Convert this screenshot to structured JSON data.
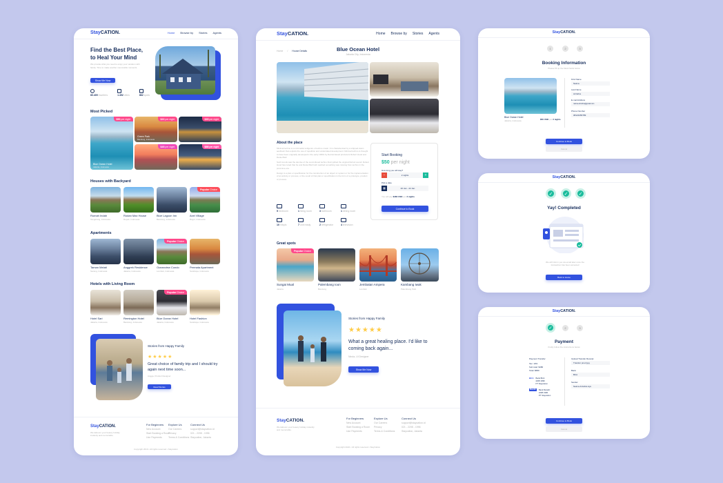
{
  "brand": {
    "stay": "Stay",
    "cation": "CATION."
  },
  "colors": {
    "primary": "#3252df",
    "navy": "#152c5b",
    "pink": "#ff498b",
    "green": "#1abc9c",
    "gray": "#b0b0b0"
  },
  "nav": {
    "home": "Home",
    "browse": "Browse by",
    "stories": "Stories",
    "agents": "Agents"
  },
  "landing": {
    "hero_title_1": "Find the Best Place,",
    "hero_title_2": "to Heal Your Mind",
    "hero_text": "We provide what you need to enjoy your vacation with family. Time to make another memorable moments.",
    "hero_button": "Show Me Now",
    "stats": [
      {
        "value": "80.409",
        "label": "travelers",
        "icon": "traveler-icon"
      },
      {
        "value": "1.492",
        "label": "cities",
        "icon": "treasure-icon"
      },
      {
        "value": "862",
        "label": "spots",
        "icon": "city-icon"
      }
    ],
    "most_picked_title": "Most Picked",
    "most_picked": [
      {
        "name": "Blue Ocean Hotel",
        "place": "Jakarta, Indonesia",
        "price": "$50",
        "unit": "per night"
      },
      {
        "name": "Green Park",
        "place": "Bandung, Indonesia",
        "price": "$22",
        "unit": "per night"
      },
      {
        "name": "",
        "place": "",
        "price": "$35",
        "unit": "per night"
      },
      {
        "name": "",
        "place": "",
        "price": "$45",
        "unit": "per night"
      },
      {
        "name": "",
        "place": "",
        "price": "$30",
        "unit": "per night"
      }
    ],
    "backyard_title": "Houses with Backyard",
    "backyard": [
      {
        "name": "Rumah Indah",
        "place": "Tangerang, Indonesia",
        "tag": ""
      },
      {
        "name": "Rodan Max House",
        "place": "Depok, Indonesia",
        "tag": ""
      },
      {
        "name": "Blue Lagoon Inn",
        "place": "Bandung, Indonesia",
        "tag": ""
      },
      {
        "name": "Axel Village",
        "place": "Bogor, Indonesia",
        "tag_b": "Popular",
        "tag": "Choice"
      }
    ],
    "apartments_title": "Apartments",
    "apartments": [
      {
        "name": "Taman Melati",
        "place": "Serang, Indonesia",
        "tag": ""
      },
      {
        "name": "Anggrek Residence",
        "place": "Jakarta, Indonesia",
        "tag": ""
      },
      {
        "name": "Oceanview Condo",
        "place": "Lombok, Indonesia",
        "tag_b": "Popular",
        "tag": "Choice"
      },
      {
        "name": "Permata Apartment",
        "place": "Surabaya, Indonesia",
        "tag": ""
      }
    ],
    "living_title": "Hotels with Living Room",
    "living": [
      {
        "name": "Hotel Sari",
        "place": "Jakarta, Indonesia",
        "tag": ""
      },
      {
        "name": "Remington Hotel",
        "place": "Bandung, Indonesia",
        "tag": ""
      },
      {
        "name": "Blue Ocean Hotel",
        "place": "Jakarta, Indonesia",
        "tag_b": "Popular",
        "tag": "Choice"
      },
      {
        "name": "Hotel Fashion",
        "place": "Surabaya, Indonesia",
        "tag": ""
      }
    ],
    "testimonial_heading": "Stories from Happy Family",
    "testimonial_quote": "Great choice of family trip and I should try again next time soon...",
    "testimonial_author": "Angga, Product Designer",
    "testimonial_button": "Read Stories",
    "footer_tagline": "We kaboom your beauty holiday instantly and memorable.",
    "footer_cols": [
      {
        "title": "For Beginners",
        "items": [
          "New Account",
          "Start Booking a Room",
          "Use Payments"
        ]
      },
      {
        "title": "Explore Us",
        "items": [
          "Our Careers",
          "Privacy",
          "Terms & Conditions"
        ]
      },
      {
        "title": "Connect Us",
        "items": [
          "support@staycation.id",
          "021 - 2208 - 1996",
          "Staycation, Jakarta"
        ]
      }
    ],
    "copyright": "Copyright 2019 • All rights reserved • Staycation"
  },
  "detail": {
    "breadcrumb_home": "Home",
    "breadcrumb_sep": "/",
    "breadcrumb_current": "House Details",
    "title": "Blue Ocean Hotel",
    "subtitle": "Jakarta City, Indonesia",
    "about_title": "About the place",
    "about_p1": "Minimal techno is a minimalist subgenre of techno music. It is characterized by a stripped-down aesthetic that exploits the use of repetition and understated development. Minimal techno is thought to have been originally developed in the early 1990s by Detroit-based producers Robert Hood and Daniel Bell.",
    "about_p2": "Such trends saw the demise of the soul-infused techno that typified the original Detroit sound. Robert Hood has noted that he and Daniel Bell both realized something was missing from techno in the post-rave era.",
    "about_p3": "Design is a plan or specification for the construction of an object or system or for the implementation of an activity or process, or the result of that plan or specification in the form of a prototype, product or process.",
    "amenities": [
      {
        "value": "5",
        "label": "bedroom",
        "icon": "bed-icon"
      },
      {
        "value": "1",
        "label": "living room",
        "icon": "sofa-icon"
      },
      {
        "value": "3",
        "label": "bathroom",
        "icon": "bath-icon"
      },
      {
        "value": "1",
        "label": "dining room",
        "icon": "dining-icon"
      },
      {
        "value": "10",
        "label": "mbp/s",
        "icon": "wifi-icon"
      },
      {
        "value": "7",
        "label": "unit ready",
        "icon": "ac-icon"
      },
      {
        "value": "2",
        "label": "refrigerator",
        "icon": "fridge-icon"
      },
      {
        "value": "4",
        "label": "television",
        "icon": "tv-icon"
      }
    ],
    "booking": {
      "title": "Start Booking",
      "price": "$50",
      "unit": "per night",
      "stay_label": "How long you will stay?",
      "stay_value": "2 nights",
      "date_label": "Pick a date",
      "date_value": "20 Jan - 22 Jan",
      "summary_pre": "You will pay",
      "summary_amount": "$480 USD",
      "summary_mid": "per",
      "summary_nights": "2 nights",
      "button": "Continue to Book"
    },
    "spots_title": "Great spots",
    "spots": [
      {
        "name": "Sungai Mual",
        "place": "Jakarta",
        "tag_b": "Popular",
        "tag": "Choice"
      },
      {
        "name": "Palembang Ioon",
        "place": "Bandung",
        "tag": ""
      },
      {
        "name": "Jembatan Ampera",
        "place": "Lombok",
        "tag": ""
      },
      {
        "name": "Kambang Iwak",
        "place": "Palembang Park",
        "tag": ""
      }
    ],
    "testimonial_heading": "Stories from Happy Family",
    "testimonial_quote": "What a great healing place. I'd like to coming back again...",
    "testimonial_author": "Ninda, UI Designer",
    "testimonial_button": "Show Me Now",
    "copyright": "Copyright 2022 • All rights reserved • StayCation"
  },
  "booking_info": {
    "steps": [
      "1",
      "2",
      "3"
    ],
    "title": "Booking Information",
    "subtitle": "Please fill up the blank fields below",
    "hotel_name": "Blue Ocean Hotel",
    "hotel_place": "Jakarta, Indonesia",
    "hotel_price": "$50 USD",
    "hotel_per": "per",
    "hotel_nights": "2 nights",
    "fields": [
      {
        "label": "First Name",
        "value": "Naima"
      },
      {
        "label": "Last Name",
        "value": "Azzahra"
      },
      {
        "label": "E-mail Address",
        "value": "naima.azzahra@gmail.com"
      },
      {
        "label": "Phone Number",
        "value": "08123456789"
      }
    ],
    "continue": "Continue to Book",
    "cancel": "Cancel"
  },
  "completed": {
    "title": "Yay! Completed",
    "text": "We will inform you via email later once the transaction has been accepted",
    "button": "Back to Home"
  },
  "payment": {
    "steps": [
      "✓",
      "2",
      "3"
    ],
    "title": "Payment",
    "subtitle": "Kindly follow the instructions below",
    "transfer_title": "Payment Transfer",
    "tax": "Tax: 10%",
    "subtotal": "Sub total: $480",
    "total": "Total: $580",
    "banks": [
      {
        "bank": "BCA",
        "name": "Bank BCA",
        "acc": "2208 1996",
        "holder": "PT Staycation"
      },
      {
        "bank": "Mandiri",
        "name": "Bank Mandiri",
        "acc": "2208 1996",
        "holder": "PT Staycation"
      }
    ],
    "fields": [
      {
        "label": "Upload Transfer Receipt",
        "value": "Transfer proof.jpg"
      },
      {
        "label": "Bank",
        "value": "BCA"
      },
      {
        "label": "Sender",
        "value": "Naima Azzahra Ayu"
      }
    ],
    "continue": "Continue to Book",
    "cancel": "Cancel"
  }
}
